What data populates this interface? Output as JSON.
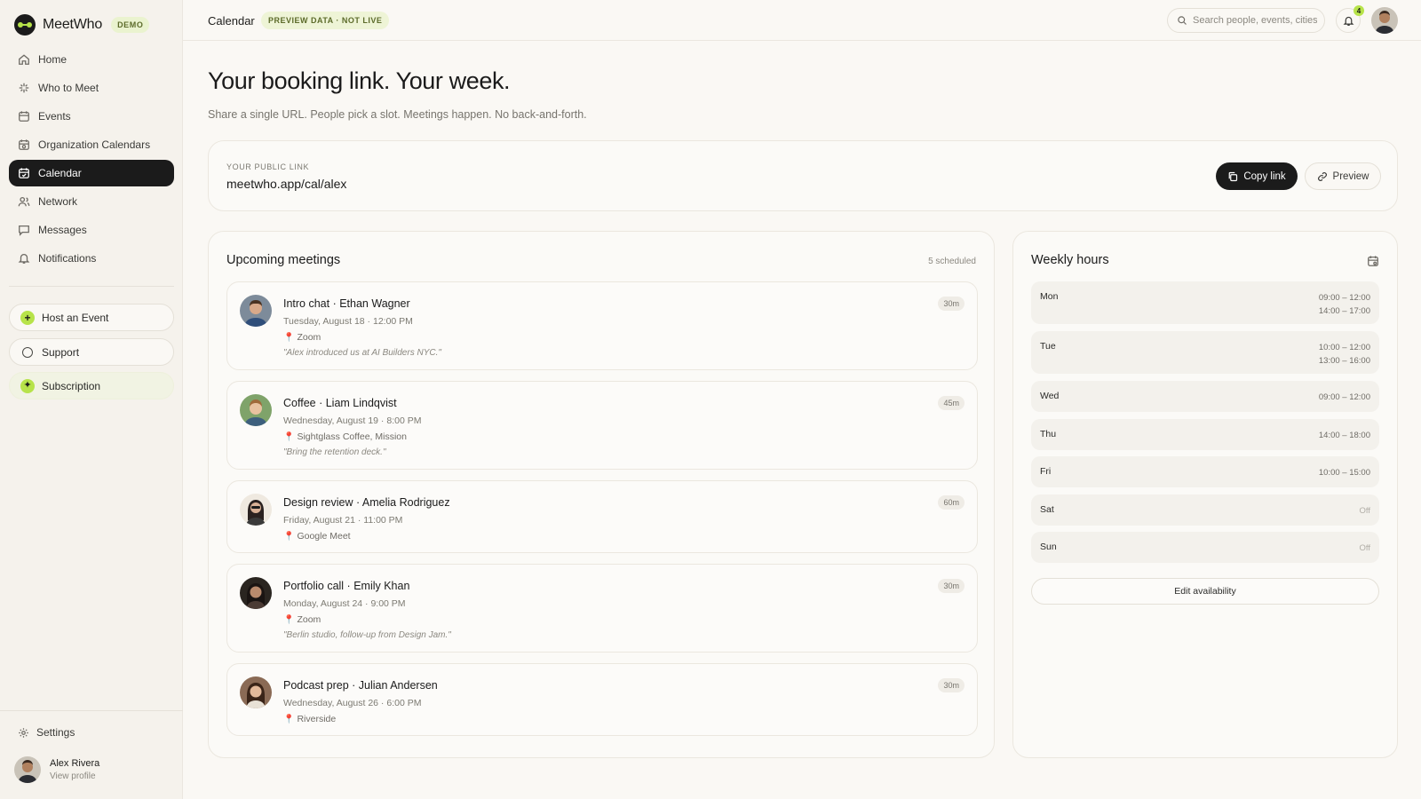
{
  "sidebar": {
    "brand": "MeetWho",
    "demo_badge": "DEMO",
    "nav": [
      {
        "label": "Home"
      },
      {
        "label": "Who to Meet"
      },
      {
        "label": "Events"
      },
      {
        "label": "Organization Calendars"
      },
      {
        "label": "Calendar"
      },
      {
        "label": "Network"
      },
      {
        "label": "Messages"
      },
      {
        "label": "Notifications"
      }
    ],
    "host_event": "Host an Event",
    "support": "Support",
    "subscription": "Subscription",
    "settings": "Settings",
    "profile": {
      "name": "Alex Rivera",
      "sub": "View profile"
    }
  },
  "topbar": {
    "crumb": "Calendar",
    "preview_badge": "PREVIEW DATA · NOT LIVE",
    "search_placeholder": "Search people, events, cities...",
    "notification_count": "4"
  },
  "header": {
    "title": "Your booking link. Your week.",
    "subtitle": "Share a single URL. People pick a slot. Meetings happen. No back-and-forth."
  },
  "public_link": {
    "label": "YOUR PUBLIC LINK",
    "url": "meetwho.app/cal/alex",
    "copy_label": "Copy link",
    "preview_label": "Preview"
  },
  "meetings": {
    "title": "Upcoming meetings",
    "count": "5 scheduled",
    "items": [
      {
        "title": "Intro chat · Ethan Wagner",
        "time": "Tuesday, August 18 · 12:00 PM",
        "location": "Zoom",
        "note": "\"Alex introduced us at AI Builders NYC.\"",
        "duration": "30m"
      },
      {
        "title": "Coffee · Liam Lindqvist",
        "time": "Wednesday, August 19 · 8:00 PM",
        "location": "Sightglass Coffee, Mission",
        "note": "\"Bring the retention deck.\"",
        "duration": "45m"
      },
      {
        "title": "Design review · Amelia Rodriguez",
        "time": "Friday, August 21 · 11:00 PM",
        "location": "Google Meet",
        "note": "",
        "duration": "60m"
      },
      {
        "title": "Portfolio call · Emily Khan",
        "time": "Monday, August 24 · 9:00 PM",
        "location": "Zoom",
        "note": "\"Berlin studio, follow-up from Design Jam.\"",
        "duration": "30m"
      },
      {
        "title": "Podcast prep · Julian Andersen",
        "time": "Wednesday, August 26 · 6:00 PM",
        "location": "Riverside",
        "note": "",
        "duration": "30m"
      }
    ]
  },
  "weekly_hours": {
    "title": "Weekly hours",
    "days": [
      {
        "day": "Mon",
        "slots": [
          "09:00 – 12:00",
          "14:00 – 17:00"
        ]
      },
      {
        "day": "Tue",
        "slots": [
          "10:00 – 12:00",
          "13:00 – 16:00"
        ]
      },
      {
        "day": "Wed",
        "slots": [
          "09:00 – 12:00"
        ]
      },
      {
        "day": "Thu",
        "slots": [
          "14:00 – 18:00"
        ]
      },
      {
        "day": "Fri",
        "slots": [
          "10:00 – 15:00"
        ]
      },
      {
        "day": "Sat",
        "slots": [
          "Off"
        ]
      },
      {
        "day": "Sun",
        "slots": [
          "Off"
        ]
      }
    ],
    "edit_label": "Edit availability"
  },
  "colors": {
    "accent": "#b7e34a",
    "dark": "#1b1b1b",
    "background": "#faf8f4"
  }
}
